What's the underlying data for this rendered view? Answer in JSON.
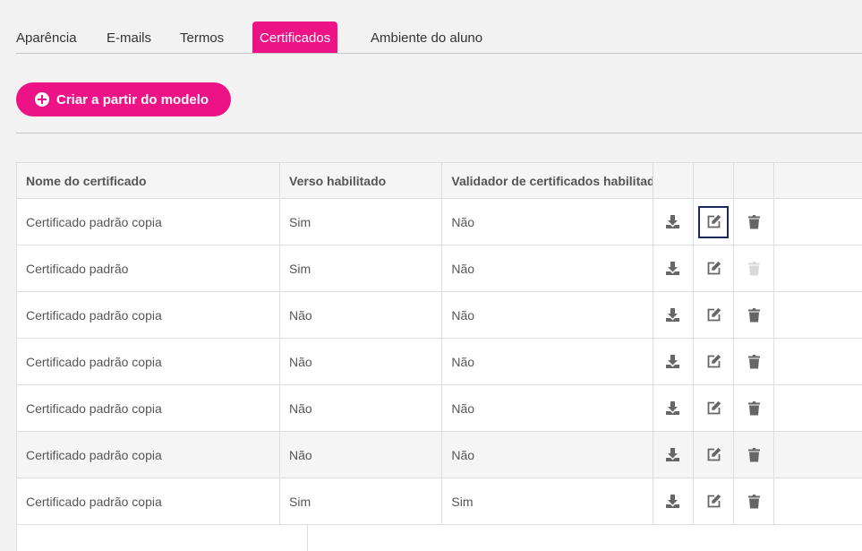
{
  "tabs": [
    {
      "label": "Aparência",
      "active": false
    },
    {
      "label": "E-mails",
      "active": false
    },
    {
      "label": "Termos",
      "active": false
    },
    {
      "label": "Certificados",
      "active": true
    },
    {
      "label": "Ambiente do aluno",
      "active": false
    }
  ],
  "create_button": {
    "label": "Criar a partir do modelo",
    "icon": "plus-circle-icon"
  },
  "colors": {
    "accent": "#ee1287",
    "icon": "#666666",
    "icon_disabled": "#d9d9d9",
    "focus_border": "#1a2a5c"
  },
  "table": {
    "columns": [
      "Nome do certificado",
      "Verso habilitado",
      "Validador de certificados habilitado"
    ],
    "action_icons": [
      "download-icon",
      "edit-icon",
      "trash-icon"
    ],
    "rows": [
      {
        "name": "Certificado padrão copia",
        "verso": "Sim",
        "validador": "Não"
      },
      {
        "name": "Certificado padrão",
        "verso": "Sim",
        "validador": "Não"
      },
      {
        "name": "Certificado padrão copia",
        "verso": "Não",
        "validador": "Não"
      },
      {
        "name": "Certificado padrão copia",
        "verso": "Não",
        "validador": "Não"
      },
      {
        "name": "Certificado padrão copia",
        "verso": "Não",
        "validador": "Não"
      },
      {
        "name": "Certificado padrão copia",
        "verso": "Não",
        "validador": "Não"
      },
      {
        "name": "Certificado padrão copia",
        "verso": "Sim",
        "validador": "Sim"
      }
    ]
  }
}
